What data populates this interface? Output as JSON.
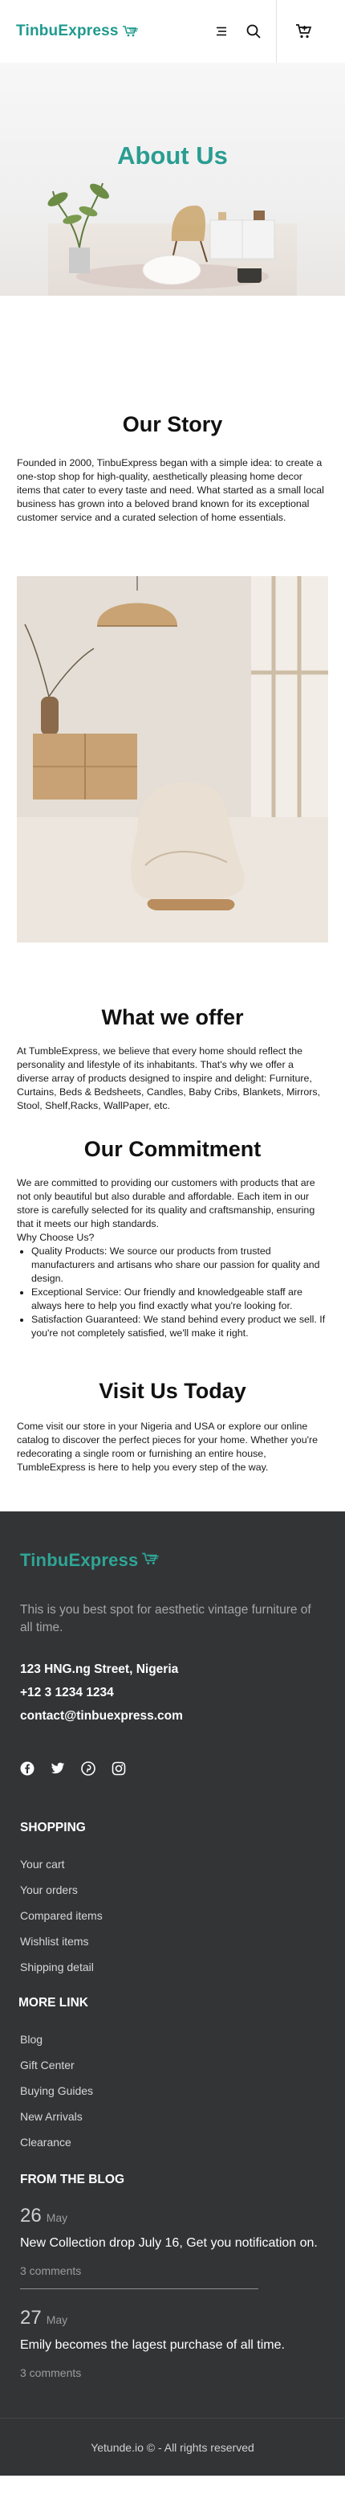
{
  "header": {
    "logo_text": "TinbuExpress",
    "icons": [
      "cart-logo-icon",
      "menu-icon",
      "search-icon",
      "cart-icon"
    ]
  },
  "hero": {
    "title": "About Us"
  },
  "story": {
    "title": "Our Story",
    "text": "Founded in 2000, TinbuExpress began with a simple idea: to create a one-stop shop for high-quality, aesthetically pleasing home decor items that cater to every taste and need. What started as a small local business has grown into a beloved brand known for its exceptional customer service and a curated selection of home essentials."
  },
  "offer": {
    "title": "What we offer",
    "text": "At TumbleExpress, we believe that every home should reflect the personality and lifestyle of its inhabitants. That's why we offer a diverse array of products designed to inspire and delight: Furniture, Curtains, Beds & Bedsheets, Candles, Baby Cribs, Blankets, Mirrors, Stool, Shelf,Racks, WallPaper, etc."
  },
  "commitment": {
    "title": "Our Commitment",
    "text": "We are committed to providing our customers with products that are not only beautiful but also durable and affordable. Each item in our store is carefully selected for its quality and craftsmanship, ensuring that it meets our high standards.",
    "why_label": "Why Choose Us?",
    "points": [
      "Quality Products: We source our products from trusted manufacturers and artisans who share our passion for quality and design.",
      "Exceptional Service: Our friendly and knowledgeable staff are always here to help you find exactly what you're looking for.",
      "Satisfaction Guaranteed: We stand behind every product we sell. If you're not completely satisfied, we'll make it right."
    ]
  },
  "visit": {
    "title": "Visit Us Today",
    "text": "Come visit our store in your Nigeria and USA or explore our online catalog to discover the perfect pieces for your home. Whether you're redecorating a single room or furnishing an entire house, TumbleExpress is here to help you every step of the way."
  },
  "footer": {
    "logo_text": "TinbuExpress",
    "tagline": "This is you best spot for aesthetic vintage furniture of all time.",
    "address": "123 HNG.ng Street, Nigeria",
    "phone": "+12 3 1234 1234",
    "email": "contact@tinbuexpress.com",
    "social_icons": [
      "facebook-icon",
      "twitter-icon",
      "pinterest-icon",
      "instagram-icon"
    ],
    "shopping_heading": "SHOPPING",
    "shopping_links": [
      "Your cart",
      "Your orders",
      "Compared items",
      "Wishlist items",
      "Shipping detail"
    ],
    "more_heading": "MORE LINK",
    "more_links": [
      "Blog",
      "Gift Center",
      "Buying Guides",
      "New Arrivals",
      "Clearance"
    ],
    "blog_heading": "FROM THE BLOG",
    "blog_posts": [
      {
        "day": "26",
        "month": "May",
        "title": "New Collection drop July 16, Get you notification on.",
        "comments": "3 comments"
      },
      {
        "day": "27",
        "month": "May",
        "title": "Emily becomes the lagest purchase of all time.",
        "comments": "3 comments"
      }
    ],
    "copyright": "Yetunde.io © - All rights reserved"
  },
  "colors": {
    "brand": "#2a9d91",
    "footer_bg": "#333436"
  }
}
